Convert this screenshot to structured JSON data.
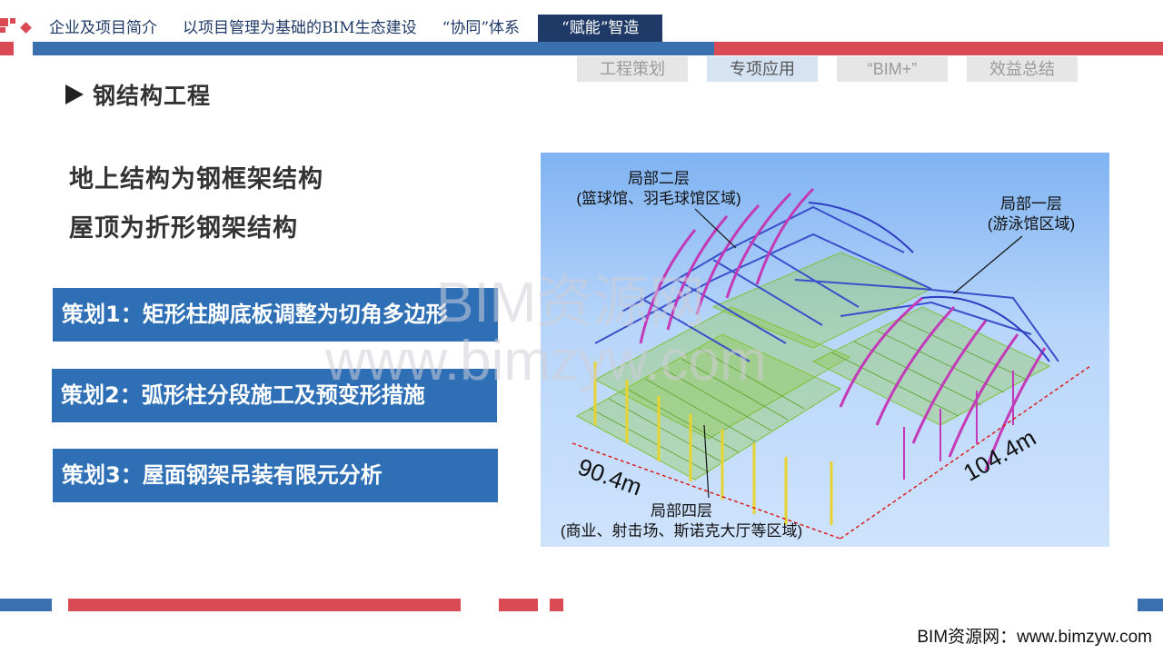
{
  "nav": {
    "tabs": [
      "企业及项目简介",
      "以项目管理为基础的BIM生态建设",
      "“协同”体系",
      "“赋能”智造"
    ],
    "active_index": 3
  },
  "sub_tabs": {
    "items": [
      "工程策划",
      "专项应用",
      "“BIM+”",
      "效益总结"
    ],
    "active_index": 1
  },
  "section": {
    "icon": "play-triangle-icon",
    "heading": "钢结构工程"
  },
  "intro": {
    "line1": "地上结构为钢框架结构",
    "line2": "屋顶为折形钢架结构"
  },
  "strategies": [
    "策划1：矩形柱脚底板调整为切角多边形",
    "策划2：弧形柱分段施工及预变形措施",
    "策划3：屋面钢架吊装有限元分析"
  ],
  "figure": {
    "label_top": {
      "title": "局部二层",
      "detail": "(篮球馆、羽毛球馆区域)"
    },
    "label_right": {
      "title": "局部一层",
      "detail": "(游泳馆区域)"
    },
    "label_bottom": {
      "title": "局部四层",
      "detail": "(商业、射击场、斯诺克大厅等区域)"
    },
    "dim_left": "90.4m",
    "dim_right": "104.4m"
  },
  "watermark": {
    "title": "BIM资源网",
    "url": "www.bimzyw.com"
  },
  "footer": {
    "site": "BIM资源网：www.bimzyw.com"
  },
  "colors": {
    "accent_red": "#d94a55",
    "accent_blue": "#3a6fb0",
    "navy": "#1f3a66",
    "strategy_blue": "#2e6fb6"
  }
}
